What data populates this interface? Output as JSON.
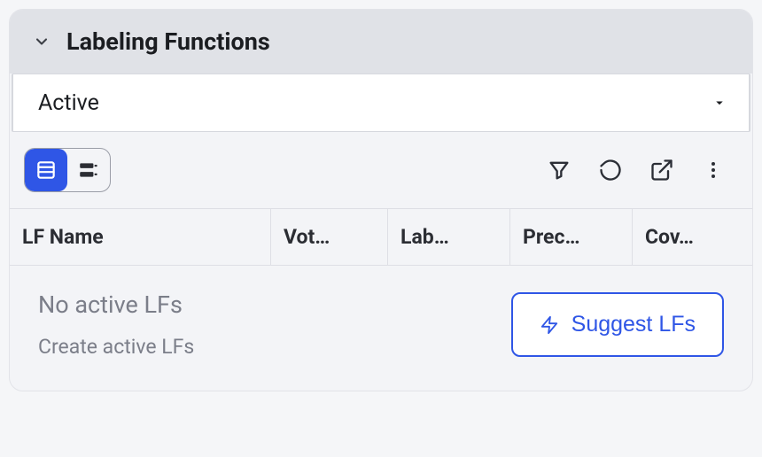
{
  "panel": {
    "title": "Labeling Functions"
  },
  "dropdown": {
    "selected": "Active"
  },
  "table": {
    "columns": [
      "LF Name",
      "Voters",
      "Labels",
      "Precision",
      "Coverage"
    ],
    "empty": {
      "primary": "No active LFs",
      "secondary": "Create active LFs"
    }
  },
  "actions": {
    "suggest_label": "Suggest LFs"
  }
}
